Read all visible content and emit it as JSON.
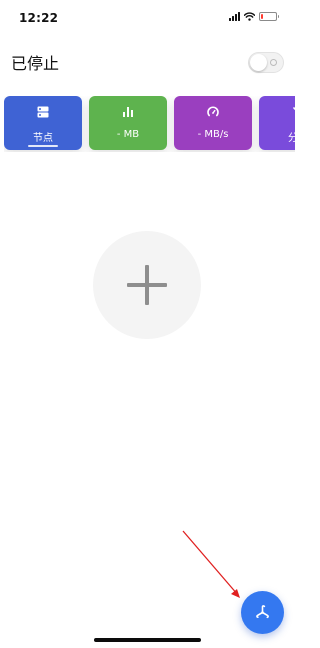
{
  "status_bar": {
    "time": "12:22",
    "signal_icon": "cellular-signal-icon",
    "wifi_icon": "wifi-icon",
    "battery_icon": "battery-icon",
    "battery_level": 0.12,
    "battery_color": "#ff3b30"
  },
  "header": {
    "title": "已停止",
    "toggle": {
      "state": "off"
    }
  },
  "cards": [
    {
      "label": "节点",
      "icon": "server-icon",
      "color": "#3f63d4",
      "selected": true
    },
    {
      "label": "- MB",
      "icon": "bar-chart-icon",
      "color": "#5eb34e",
      "selected": false
    },
    {
      "label": "- MB/s",
      "icon": "speedometer-icon",
      "color": "#9a3fbf",
      "selected": false
    },
    {
      "label": "分流",
      "icon": "route-icon",
      "color": "#7a4bdb",
      "selected": false
    }
  ],
  "main": {
    "add_button": {
      "icon": "plus-icon"
    }
  },
  "fab": {
    "icon": "fan-icon",
    "color": "#3478f0"
  },
  "annotation": {
    "arrow_color": "#e02020"
  }
}
